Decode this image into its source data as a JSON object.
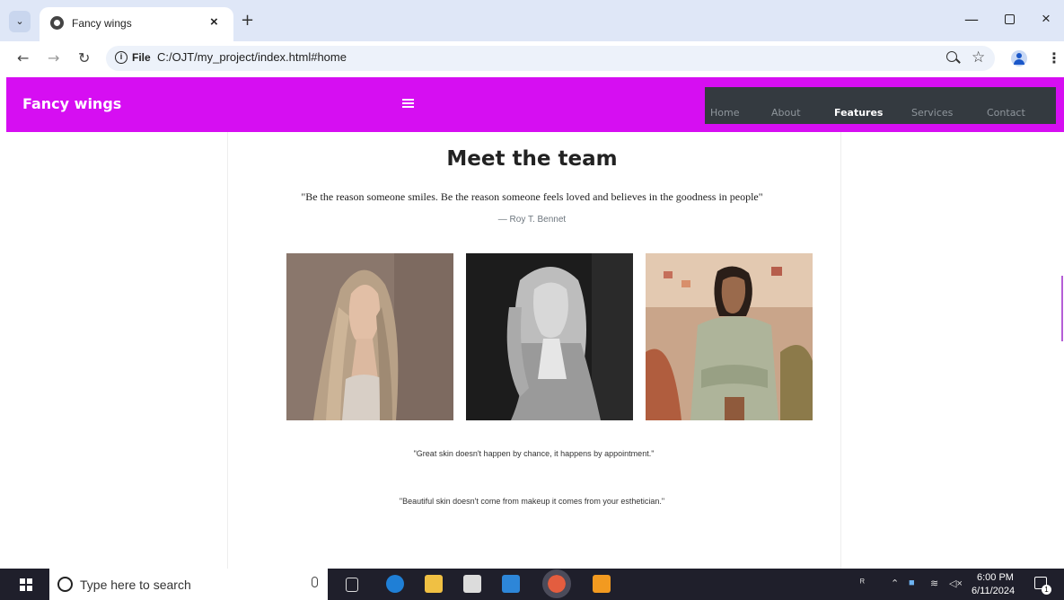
{
  "browser": {
    "tab_title": "Fancy wings",
    "address_label": "File",
    "url": "C:/OJT/my_project/index.html#home"
  },
  "site": {
    "brand": "Fancy wings",
    "menu": [
      {
        "label": "Home",
        "active": false
      },
      {
        "label": "About",
        "active": false
      },
      {
        "label": "Features",
        "active": true
      },
      {
        "label": "Services",
        "active": false
      },
      {
        "label": "Contact",
        "active": false
      }
    ],
    "accent_color": "#d60ef2"
  },
  "team": {
    "title": "Meet the team",
    "quote": "\"Be the reason someone smiles. Be the reason someone feels loved and believes in the goodness in people\"",
    "author": "— Roy T. Bennet",
    "photos": [
      "team-member-photo-1",
      "team-member-photo-2",
      "team-member-photo-3"
    ],
    "sayings": [
      "\"Great skin doesn't happen by chance, it happens by appointment.\"",
      "\"Beautiful skin doesn't come from makeup it comes from your esthetician.\""
    ]
  },
  "taskbar": {
    "search_placeholder": "Type here to search",
    "time": "6:00 PM",
    "date": "6/11/2024",
    "notification_count": "1"
  }
}
